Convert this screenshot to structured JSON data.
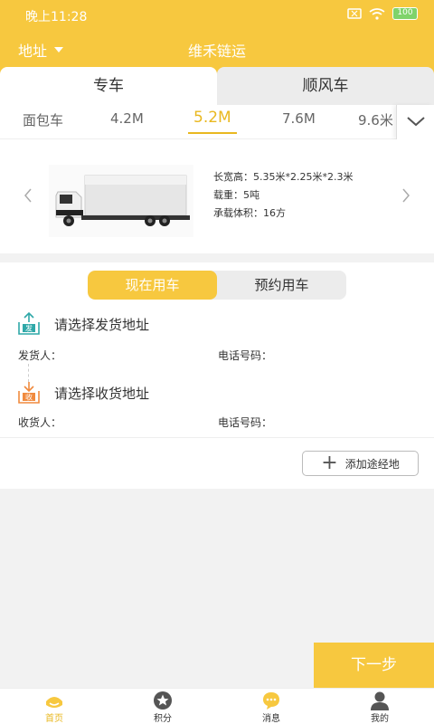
{
  "status": {
    "time": "晚上11:28",
    "battery": "100"
  },
  "header": {
    "address": "地址",
    "title": "维禾链运"
  },
  "tabs": [
    {
      "label": "专车",
      "active": true
    },
    {
      "label": "顺风车",
      "active": false
    }
  ],
  "sizes": [
    {
      "label": "面包车",
      "active": false
    },
    {
      "label": "4.2M",
      "active": false
    },
    {
      "label": "5.2M",
      "active": true
    },
    {
      "label": "7.6M",
      "active": false
    },
    {
      "label": "9.6米",
      "active": false
    }
  ],
  "vehicle": {
    "dimensions": "长宽高：5.35米*2.25米*2.3米",
    "load": "载重：5吨",
    "volume": "承载体积：16方"
  },
  "segment": {
    "now": "现在用车",
    "reserve": "预约用车"
  },
  "shipping": {
    "origin_prompt": "请选择发货地址",
    "origin_icon_text": "发",
    "sender_label": "发货人：",
    "sender_phone_label": "电话号码：",
    "dest_prompt": "请选择收货地址",
    "dest_icon_text": "收",
    "receiver_label": "收货人：",
    "receiver_phone_label": "电话号码："
  },
  "via_button": "添加途经地",
  "next_button": "下一步",
  "colors": {
    "accent": "#f7c83f",
    "accent_text": "#e9b820",
    "origin_icon": "#2fa8a8",
    "dest_icon": "#f08a3e"
  },
  "nav": [
    {
      "label": "首页",
      "icon": "home-icon",
      "active": true
    },
    {
      "label": "积分",
      "icon": "star-icon",
      "active": false
    },
    {
      "label": "消息",
      "icon": "message-icon",
      "active": false
    },
    {
      "label": "我的",
      "icon": "person-icon",
      "active": false
    }
  ]
}
